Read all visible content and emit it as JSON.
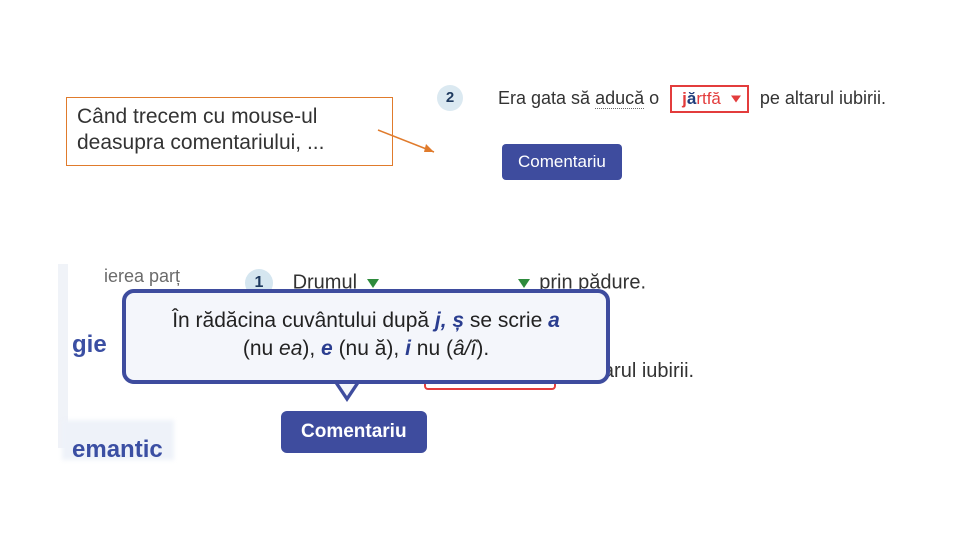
{
  "callout": {
    "text": "Când trecem cu mouse-ul deasupra comentariului, ..."
  },
  "q2_top": {
    "number": "2",
    "sentence_before": "Era gata să ",
    "sentence_dotted": "aducă",
    "sentence_mid": " o ",
    "answer_j": "j",
    "answer_a": "ă",
    "answer_rest": "rtfă",
    "sentence_after": " pe altarul iubirii."
  },
  "comment_button": {
    "label": "Comentariu"
  },
  "lower_scene": {
    "crop_topleft": "ierea parț",
    "crop_gie": "gie",
    "crop_emantic": "emantic",
    "q1": {
      "number": "1",
      "word1_prefix": "Drumul",
      "tail": "prin pădure."
    },
    "q2_tail": "pe altarul iubirii."
  },
  "tooltip": {
    "line1_a": "În rădăcina cuvântului după ",
    "line1_j": "j, ș",
    "line1_b": " se scrie ",
    "line1_a2": "a",
    "line2_a": "(nu ",
    "line2_ea": "ea",
    "line2_b": "), ",
    "line2_e": "e",
    "line2_c": " (nu ă), ",
    "line2_i": "i",
    "line2_d": " nu (",
    "line2_ai": "â/î",
    "line2_e2": ")."
  },
  "colors": {
    "accent_blue": "#3e4c9e",
    "accent_red": "#e33c3c",
    "callout_border": "#E07B2C"
  }
}
